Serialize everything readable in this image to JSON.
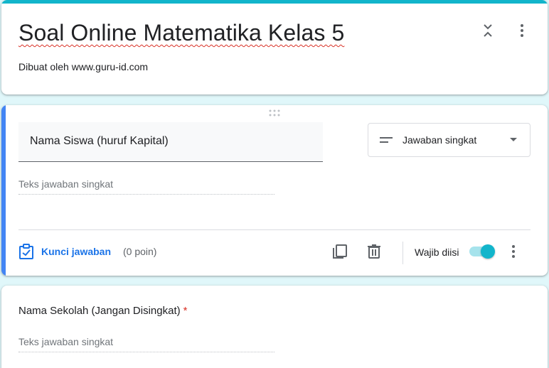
{
  "form": {
    "title": "Soal Online Matematika Kelas 5",
    "description": "Dibuat oleh www.guru-id.com"
  },
  "questions": [
    {
      "title": "Nama Siswa (huruf Kapital)",
      "type": "Jawaban singkat",
      "answer_placeholder": "Teks jawaban singkat",
      "answer_key_label": "Kunci jawaban",
      "points": "(0 poin)",
      "required_label": "Wajib diisi",
      "required": true
    },
    {
      "title": "Nama Sekolah (Jangan Disingkat)",
      "required_mark": "*",
      "answer_placeholder": "Teks jawaban singkat"
    }
  ],
  "icons": {
    "collapse": "collapse-icon",
    "more": "more-vert-icon",
    "drag": "drag-handle-icon",
    "short_answer": "short-text-icon",
    "dropdown": "arrow-drop-down-icon",
    "answer_key": "assignment-check-icon",
    "copy": "copy-icon",
    "delete": "trash-icon"
  },
  "colors": {
    "theme": "#12b5cb",
    "active_accent": "#4285f4",
    "background": "#e0f7fa",
    "link": "#1a73e8",
    "required": "#d93025"
  }
}
